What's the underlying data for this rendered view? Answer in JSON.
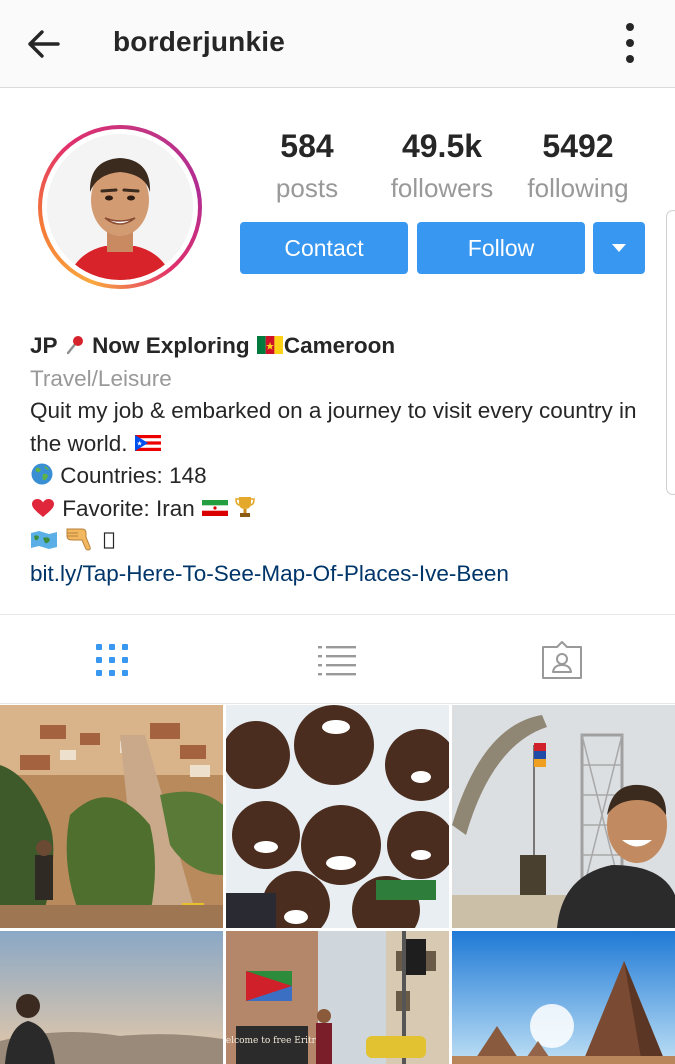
{
  "header": {
    "username": "borderjunkie"
  },
  "stats": [
    {
      "value": "584",
      "label": "posts"
    },
    {
      "value": "49.5k",
      "label": "followers"
    },
    {
      "value": "5492",
      "label": "following"
    }
  ],
  "actions": {
    "contact": "Contact",
    "follow": "Follow"
  },
  "bio": {
    "name_prefix": "JP",
    "name_middle": "Now Exploring",
    "name_suffix": "Cameroon",
    "category": "Travel/Leisure",
    "description": "Quit my job & embarked on a journey to visit every country in the world.",
    "countries": "Countries: 148",
    "favorite": "Favorite: Iran",
    "link": "bit.ly/Tap-Here-To-See-Map-Of-Places-Ive-Been"
  },
  "tabs": [
    {
      "name": "grid-view",
      "active": true
    },
    {
      "name": "list-view",
      "active": false
    },
    {
      "name": "tagged-photos",
      "active": false
    }
  ],
  "photos": [
    {
      "subject": "street-hill-town"
    },
    {
      "subject": "children-group"
    },
    {
      "subject": "monument-arch"
    },
    {
      "subject": "sunset-hiker"
    },
    {
      "subject": "welcome-to-free-eritrea"
    },
    {
      "subject": "pyramids"
    }
  ],
  "photo_text": {
    "eritrea_sign": "Welcome to free Eritrea"
  },
  "colors": {
    "accent": "#3897f0",
    "link": "#003569",
    "muted": "#999999",
    "text": "#262626"
  }
}
